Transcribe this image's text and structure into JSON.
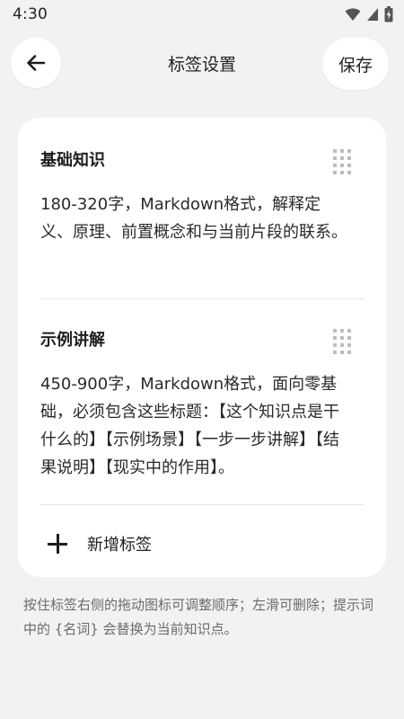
{
  "status_bar": {
    "time": "4:30"
  },
  "header": {
    "title": "标签设置",
    "save_label": "保存"
  },
  "tags": [
    {
      "name": "基础知识",
      "prompt": "180-320字，Markdown格式，解释定义、原理、前置概念和与当前片段的联系。"
    },
    {
      "name": "示例讲解",
      "prompt": "450-900字，Markdown格式，面向零基础，必须包含这些标题：【这个知识点是干什么的】【示例场景】【一步一步讲解】【结果说明】【现实中的作用】。"
    }
  ],
  "add_tag_label": "新增标签",
  "hint": "按住标签右侧的拖动图标可调整顺序；左滑可删除；提示词中的 {名词} 会替换为当前知识点。",
  "icons": {
    "back": "arrow-left-icon",
    "drag": "drag-handle-icon",
    "add": "plus-icon",
    "wifi": "wifi-icon",
    "signal": "signal-icon",
    "battery": "battery-charging-icon"
  }
}
